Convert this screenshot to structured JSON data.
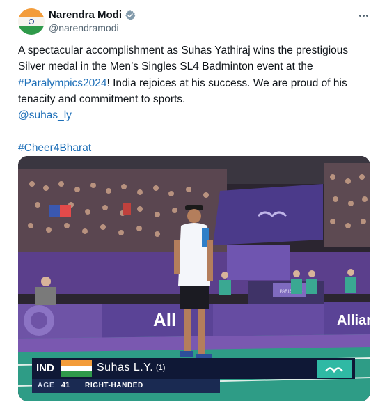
{
  "author": {
    "display_name": "Narendra Modi",
    "handle": "@narendramodi",
    "verified": true,
    "avatar": "indian-flag-avatar"
  },
  "menu": {
    "icon": "more-icon"
  },
  "tweet": {
    "line1": "A spectacular accomplishment as Suhas Yathiraj wins the prestigious",
    "line2": "Silver medal in the Men’s Singles SL4 Badminton event at the",
    "hashtag_paralympics": "#Paralympics2024",
    "line3_rest": "! India rejoices at his success. We are proud of his",
    "line4": "tenacity and commitment to sports.",
    "mention": "@suhas_ly",
    "hashtag_cheer": "#Cheer4Bharat"
  },
  "media": {
    "type": "photo",
    "venue_signs": {
      "ad_all": "All",
      "ad_allianz": "Allianz",
      "paris_board": "PARIS 2024"
    },
    "caption": {
      "country": "IND",
      "name": "Suhas L.Y.",
      "seed": "(1)",
      "age_label": "AGE",
      "age": "41",
      "hand": "RIGHT-HANDED"
    }
  },
  "colors": {
    "link": "#1d6fb8",
    "saffron": "#f39c3a",
    "green": "#2f9a4a",
    "verified": "#829aab",
    "court_purple": "#5b3f8c"
  }
}
